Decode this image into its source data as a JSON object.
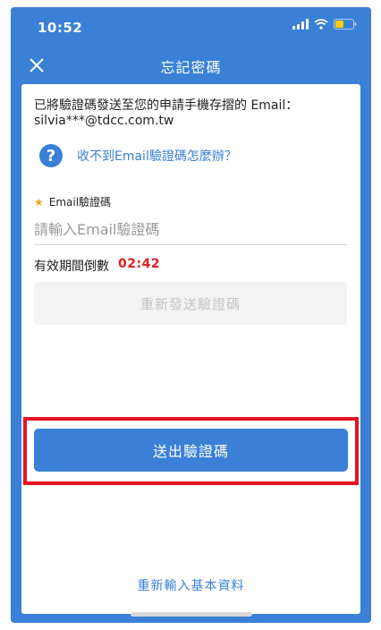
{
  "status_bar": {
    "time": "10:52"
  },
  "nav": {
    "title": "忘記密碼"
  },
  "description": "已將驗證碼發送至您的申請手機存摺的 Email：silvia***@tdcc.com.tw",
  "help": {
    "text": "收不到Email驗證碼怎麼辦？"
  },
  "code_field": {
    "label": "Email驗證碼",
    "placeholder": "請輸入Email驗證碼",
    "value": ""
  },
  "countdown": {
    "label": "有效期間倒數",
    "value": "02:42"
  },
  "buttons": {
    "resend": "重新發送驗證碼",
    "submit": "送出驗證碼",
    "reenter": "重新輸入基本資料"
  },
  "colors": {
    "primary": "#3a80d6",
    "highlight": "#e8131f",
    "countdown": "#e02020"
  },
  "icons": {
    "close": "close-icon",
    "help": "question-circle-icon"
  }
}
